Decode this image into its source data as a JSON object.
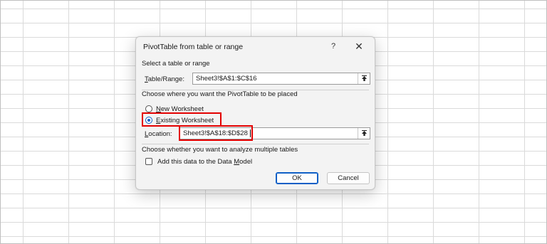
{
  "dialog": {
    "title": "PivotTable from table or range",
    "help_label": "?",
    "close_label": "✕",
    "section1": {
      "title": "Select a table or range",
      "table_range_label_prefix": "T",
      "table_range_label_rest": "able/Range:",
      "table_range_value": "Sheet3!$A$1:$C$16"
    },
    "section2": {
      "title": "Choose where you want the PivotTable to be placed",
      "new_ws_prefix": "N",
      "new_ws_rest": "ew Worksheet",
      "existing_ws_prefix": "E",
      "existing_ws_rest": "xisting Worksheet",
      "selected_option": "Existing Worksheet",
      "location_label_prefix": "L",
      "location_label_rest": "ocation:",
      "location_value": "Sheet3!$A$18:$D$28"
    },
    "section3": {
      "title": "Choose whether you want to analyze multiple tables",
      "data_model_prefix": "Add this data to the Data ",
      "data_model_underlined": "M",
      "data_model_rest": "odel",
      "data_model_checked": false
    },
    "buttons": {
      "ok": "OK",
      "cancel": "Cancel"
    }
  },
  "colors": {
    "highlight": "#e30000",
    "accent": "#0f5fc6"
  }
}
